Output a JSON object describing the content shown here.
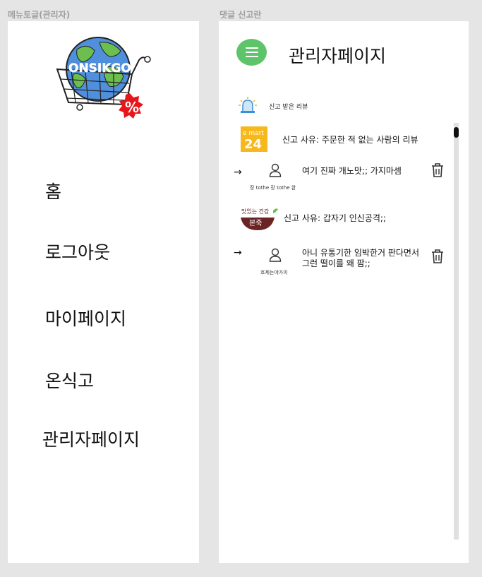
{
  "frames": {
    "menu_label": "메뉴토글(관리자)",
    "report_label": "댓글 신고란"
  },
  "logo": {
    "text": "ONSIKGO",
    "badge": "%"
  },
  "menu": {
    "items": [
      {
        "label": "홈"
      },
      {
        "label": "로그아웃"
      },
      {
        "label": "마이페이지"
      },
      {
        "label": "온식고"
      },
      {
        "label": "관리자페이지"
      }
    ]
  },
  "header": {
    "title": "관리자페이지",
    "menu_icon": "hamburger-icon"
  },
  "section": {
    "label": "신고 받은 리뷰",
    "icon": "siren-icon"
  },
  "reports": [
    {
      "brand": {
        "name": "emart24",
        "top": "e mart",
        "bottom": "24",
        "color": "#f7b81e"
      },
      "reason": "신고 사유: 주문한 적 없는 사람의 리뷰",
      "user": "장 tothe 장 tothe 완",
      "comment": [
        "여기 진짜 개노맛;; 가지마셈"
      ]
    },
    {
      "brand": {
        "name": "본죽",
        "top": "맛있는 건강",
        "bottom": "본죽",
        "color": "#6b2424"
      },
      "reason": "신고 사유: 갑자기 인신공격;;",
      "user": "호제는야가이",
      "comment": [
        "아니 유통기한 임박한거 판다면서",
        "그런 떨이를 왜 팜;;"
      ]
    }
  ],
  "icons": {
    "arrow": "→",
    "user": "user-icon",
    "delete": "trash-icon"
  },
  "colors": {
    "accent": "#5ec46a",
    "background": "#e5e5e5"
  }
}
